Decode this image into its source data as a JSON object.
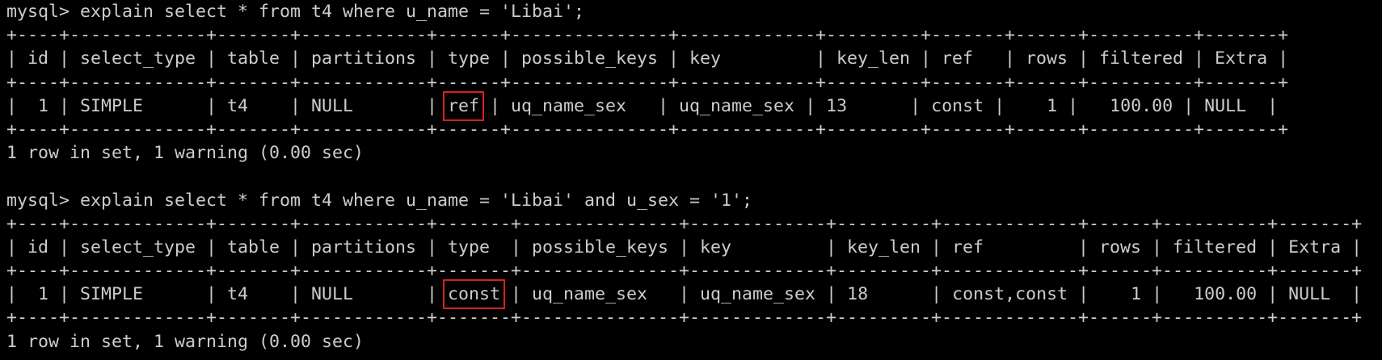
{
  "queries": [
    {
      "command": "mysql> explain select * from t4 where u_name = 'Libai';",
      "border": "+----+-------------+-------+------------+------+---------------+-------------+---------+-------+------+----------+-------+",
      "header": "| id | select_type | table | partitions | type | possible_keys | key         | key_len | ref   | rows | filtered | Extra |",
      "row_prefix": "|  1 | SIMPLE      | t4    | NULL       | ",
      "row_type": "ref",
      "row_suffix": " | uq_name_sex   | uq_name_sex | 13      | const |    1 |   100.00 | NULL  |",
      "status": "1 row in set, 1 warning (0.00 sec)"
    },
    {
      "command": "mysql> explain select * from t4 where u_name = 'Libai' and u_sex = '1';",
      "border": "+----+-------------+-------+------------+-------+---------------+-------------+---------+-------------+------+----------+-------+",
      "header": "| id | select_type | table | partitions | type  | possible_keys | key         | key_len | ref         | rows | filtered | Extra |",
      "row_prefix": "|  1 | SIMPLE      | t4    | NULL       | ",
      "row_type": "const",
      "row_suffix": " | uq_name_sex   | uq_name_sex | 18      | const,const |    1 |   100.00 | NULL  |",
      "status": "1 row in set, 1 warning (0.00 sec)"
    }
  ],
  "colors": {
    "background": "#000000",
    "text": "#cccccc",
    "highlight_box": "#d72020"
  }
}
